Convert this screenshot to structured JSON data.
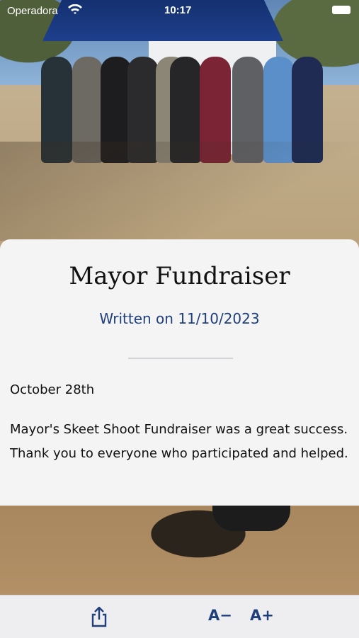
{
  "status_bar": {
    "carrier": "Operadora",
    "time": "10:17"
  },
  "article": {
    "title": "Mayor Fundraiser",
    "written_on": "Written on 11/10/2023",
    "subheading": "October 28th",
    "body": "Mayor's Skeet Shoot Fundraiser was a great success. Thank you to everyone who participated and helped."
  },
  "toolbar": {
    "share_icon": "share-icon",
    "decrease_font_label": "A−",
    "increase_font_label": "A+"
  },
  "colors": {
    "accent": "#1f3f7a",
    "card_bg": "#f4f4f5",
    "toolbar_bg": "#eeeef0"
  }
}
